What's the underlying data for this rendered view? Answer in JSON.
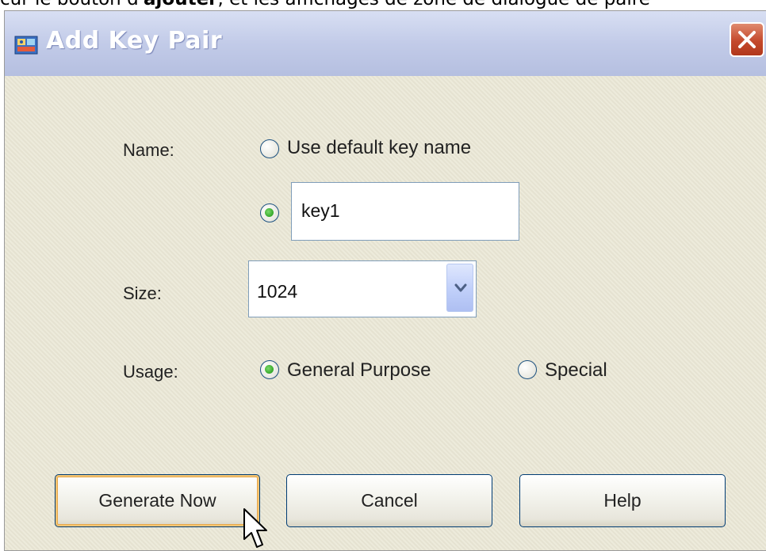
{
  "caption": {
    "prefix": "cur le bouton d'",
    "bold": "ajouter",
    "suffix": ", et les affichages de zone de dialogue de paire"
  },
  "dialog": {
    "title": "Add Key Pair",
    "icon": "key-pair-app-icon",
    "close_icon": "close-icon"
  },
  "form": {
    "name_label": "Name:",
    "option_default_label": "Use default key name",
    "option_default_selected": false,
    "option_custom_selected": true,
    "custom_key_value": "key1",
    "size_label": "Size:",
    "size_value": "1024",
    "usage_label": "Usage:",
    "usage_general_label": "General Purpose",
    "usage_general_selected": true,
    "usage_special_label": "Special",
    "usage_special_selected": false
  },
  "buttons": {
    "generate": "Generate Now",
    "cancel": "Cancel",
    "help": "Help"
  },
  "colors": {
    "titlebar": "#c2cbe8",
    "dialog_bg": "#ece9d8",
    "radio_selected": "#35a82a",
    "close_button": "#c4492c",
    "default_button_focus": "#e8a84a"
  }
}
